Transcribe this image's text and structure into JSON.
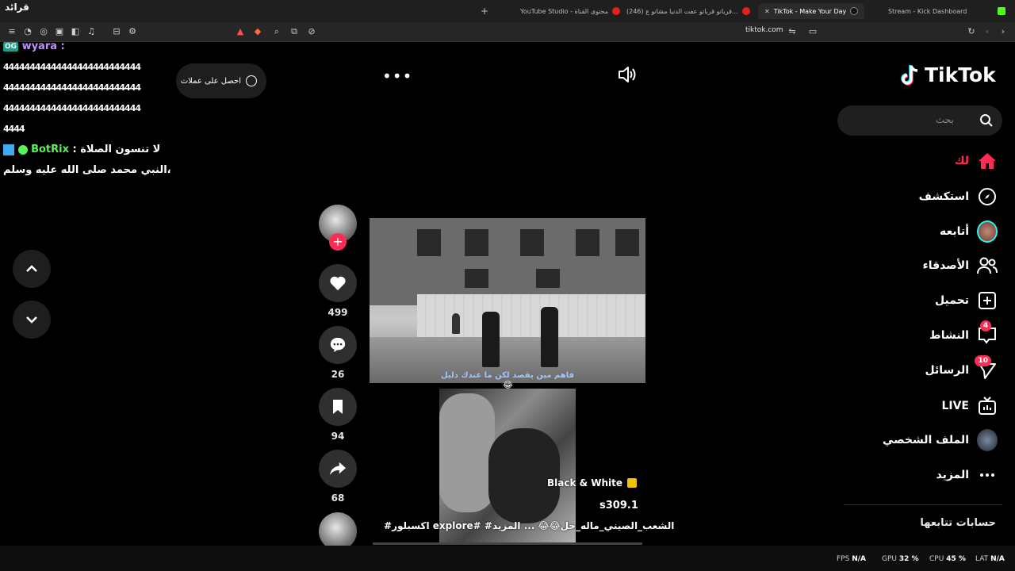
{
  "browser": {
    "tabs": [
      {
        "label": "Stream - Kick Dashboard",
        "active": false
      },
      {
        "label": "TikTok - Make Your Day",
        "active": true
      },
      {
        "label": "(246) قرباتو قرباتو عفت الدنيا مشاتو ع...",
        "active": false
      },
      {
        "label": "YouTube Studio - محتوى القناة",
        "active": false
      }
    ],
    "corner_text": "قرائد",
    "url": "tiktok.com",
    "new_tab": "+"
  },
  "chat": {
    "lines": [
      {
        "badge": "OG",
        "user": "wyara",
        "sep": " :",
        "text": ""
      },
      {
        "text": "44444444444444444444444444"
      },
      {
        "text": "44444444444444444444444444"
      },
      {
        "text": "44444444444444444444444444"
      },
      {
        "text": "4444"
      },
      {
        "user": "BotRix",
        "sep": " : ",
        "text": "لا تنسون الصلاة"
      },
      {
        "text": "النبي محمد صلى الله عليه وسلم،"
      }
    ]
  },
  "tooltip": {
    "text": "احصل على عملات"
  },
  "video": {
    "caption": "فاهم مين يقصد لكن ما عندك دليل",
    "overlay_tag": "Black & White",
    "overlay_count": "s309.1",
    "description": "#اكسبلور explore# #الشعب_الصيني_ماله_حل😂😂 ... المزيد"
  },
  "actions": {
    "likes": "499",
    "comments": "26",
    "saves": "94",
    "shares": "68",
    "follow_plus": "+"
  },
  "sidebar": {
    "logo": "TikTok",
    "search_placeholder": "بحث",
    "items": [
      {
        "label": "لك",
        "icon": "home-icon"
      },
      {
        "label": "استكشف",
        "icon": "compass-icon"
      },
      {
        "label": "أتابعه",
        "icon": "avatar-icon"
      },
      {
        "label": "الأصدقاء",
        "icon": "friends-icon"
      },
      {
        "label": "تحميل",
        "icon": "upload-icon"
      },
      {
        "label": "النشاط",
        "icon": "activity-icon",
        "badge": "4"
      },
      {
        "label": "الرسائل",
        "icon": "messages-icon",
        "badge": "10"
      },
      {
        "label": "LIVE",
        "icon": "live-icon"
      },
      {
        "label": "الملف الشخصي",
        "icon": "profile-icon"
      },
      {
        "label": "المزيد",
        "icon": "more-icon"
      }
    ],
    "following_accounts": "حسابات تتابعها"
  },
  "status": {
    "fps_label": "FPS",
    "fps_value": "N/A",
    "gpu_label": "GPU",
    "gpu_value": "32 %",
    "cpu_label": "CPU",
    "cpu_value": "45 %",
    "lat_label": "LAT",
    "lat_value": "N/A"
  },
  "colors": {
    "accent": "#fe2c55",
    "chat_user_1": "#c48fff",
    "chat_user_2": "#59f25a"
  }
}
